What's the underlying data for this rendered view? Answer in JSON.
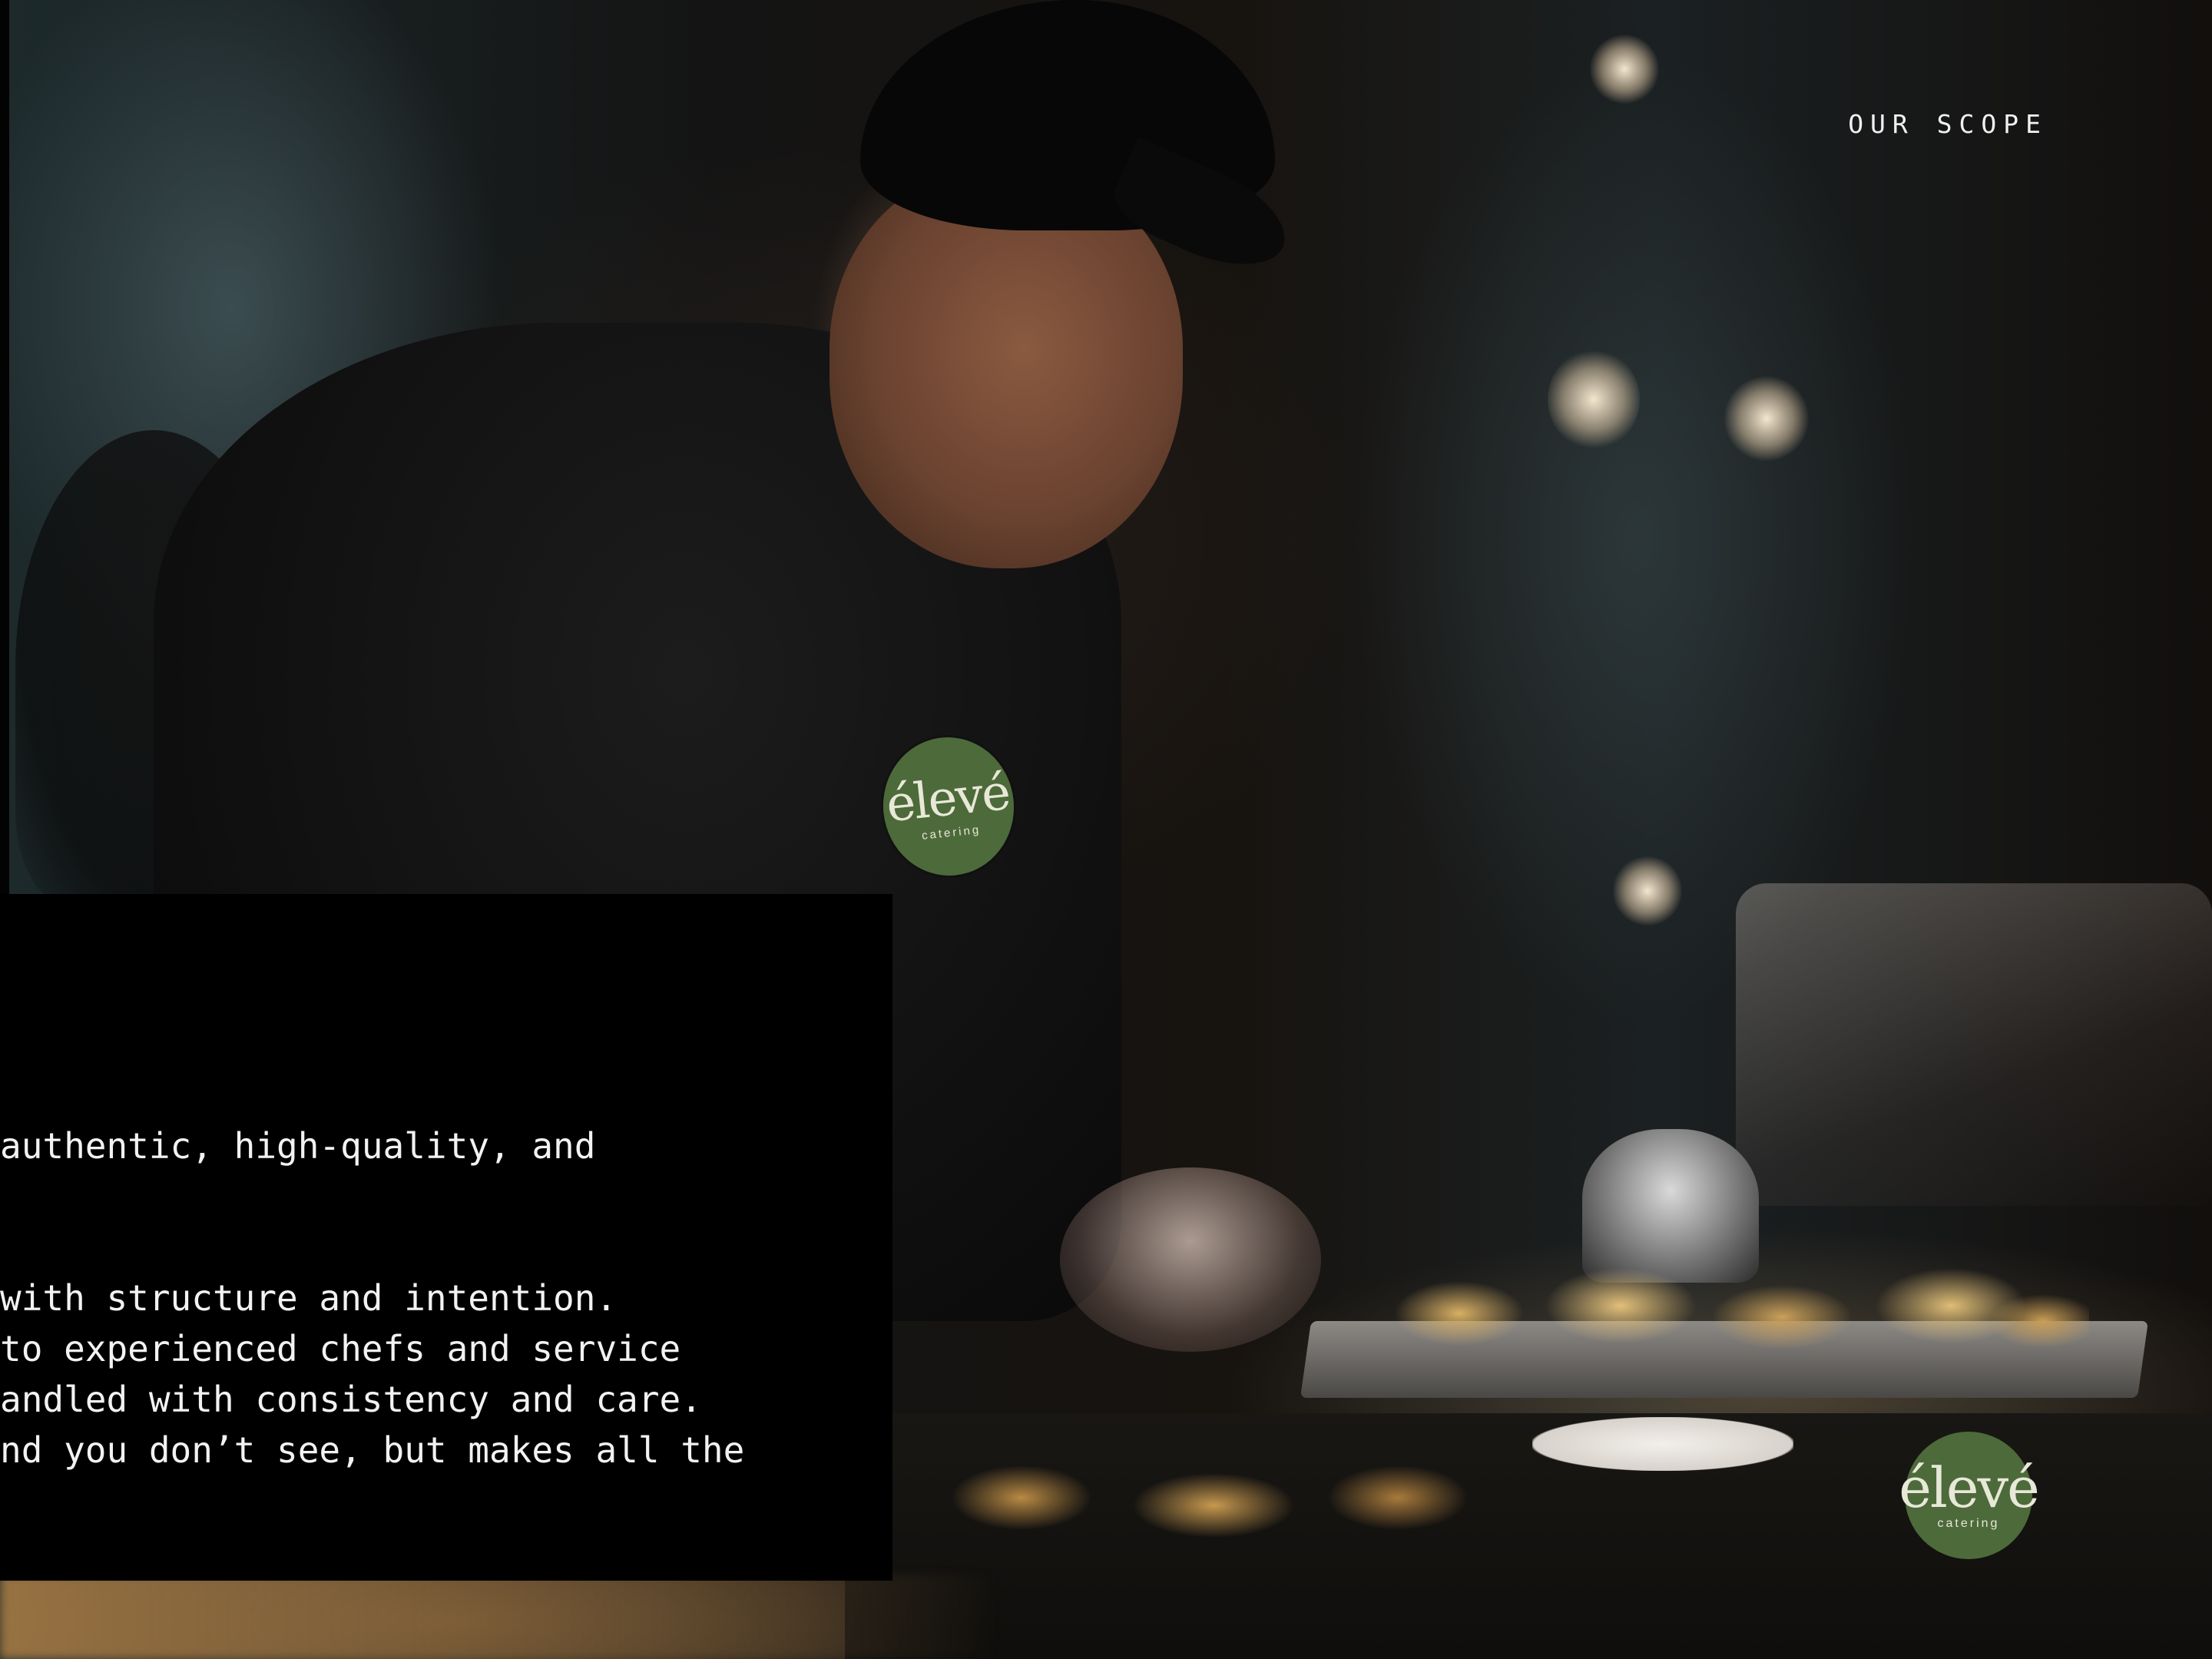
{
  "header": {
    "section_label": "OUR SCOPE"
  },
  "panel": {
    "lines": [
      "authentic, high-quality, and",
      " with structure and intention.",
      "to experienced chefs and service",
      "andled with consistency and care.",
      "nd you don’t see, but makes all the"
    ]
  },
  "brand": {
    "wordmark": "élevé",
    "tagline": "catering",
    "badge_color": "#4d6a3a"
  }
}
